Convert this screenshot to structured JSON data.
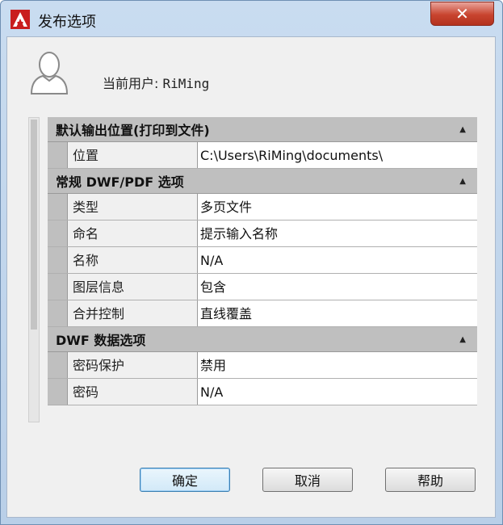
{
  "window": {
    "title": "发布选项"
  },
  "titlebar": {
    "close_label": "✕"
  },
  "user": {
    "label": "当前用户:",
    "name": "RiMing"
  },
  "sections": [
    {
      "title": "默认输出位置(打印到文件)",
      "rows": [
        {
          "key": "位置",
          "value": "C:\\Users\\RiMing\\documents\\"
        }
      ]
    },
    {
      "title": "常规 DWF/PDF 选项",
      "rows": [
        {
          "key": "类型",
          "value": "多页文件"
        },
        {
          "key": "命名",
          "value": "提示输入名称"
        },
        {
          "key": "名称",
          "value": "N/A"
        },
        {
          "key": "图层信息",
          "value": "包含"
        },
        {
          "key": "合并控制",
          "value": "直线覆盖"
        }
      ]
    },
    {
      "title": "DWF 数据选项",
      "rows": [
        {
          "key": "密码保护",
          "value": "禁用"
        },
        {
          "key": "密码",
          "value": "N/A"
        }
      ]
    }
  ],
  "buttons": {
    "ok": "确定",
    "cancel": "取消",
    "help": "帮助"
  },
  "colors": {
    "accent": "#c8442f",
    "section_header": "#bfbfbf"
  }
}
